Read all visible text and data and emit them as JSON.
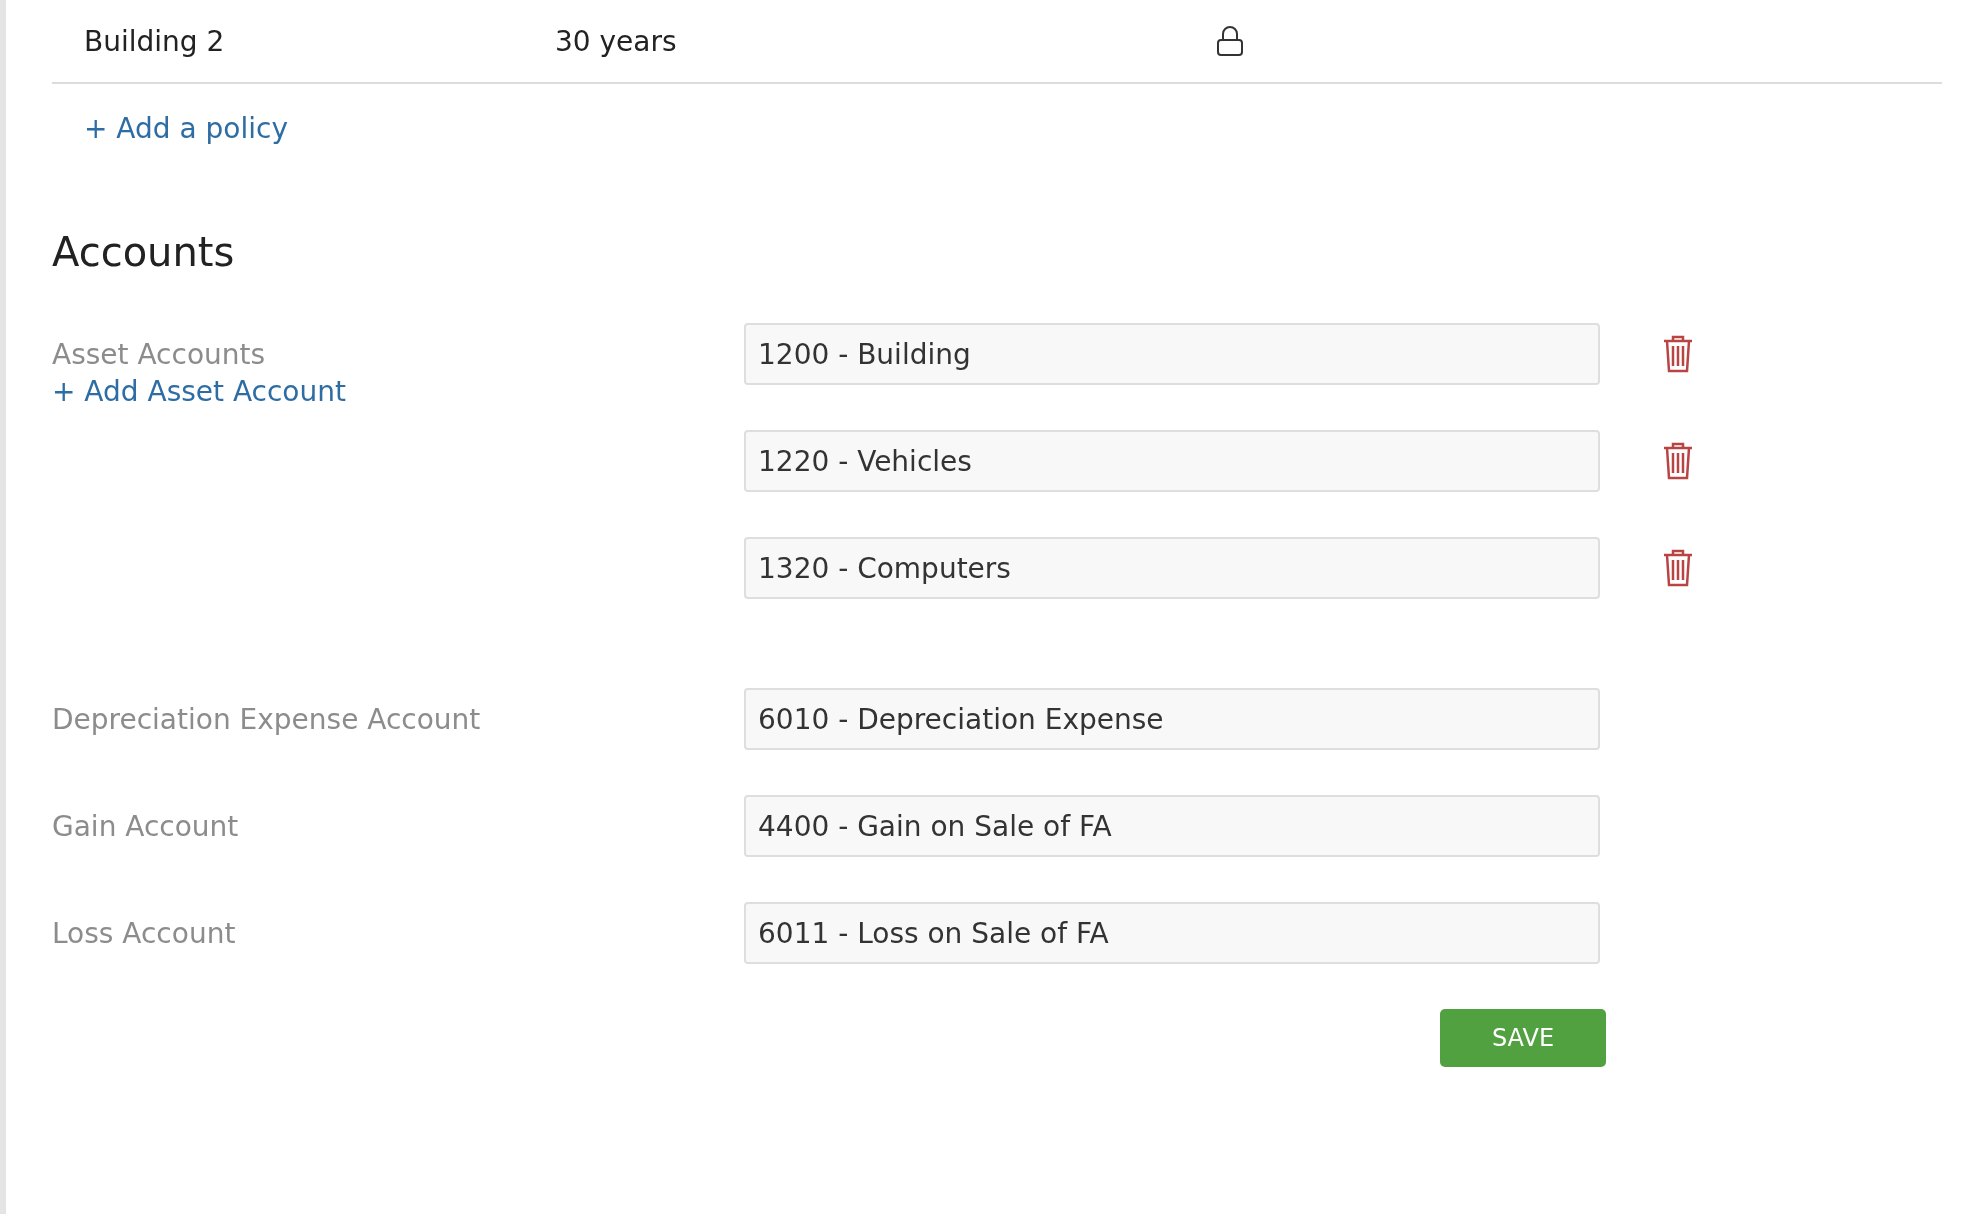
{
  "policy_row": {
    "name": "Building 2",
    "life": "30 years",
    "locked": true
  },
  "add_policy_link": "+ Add a policy",
  "accounts": {
    "title": "Accounts",
    "asset_accounts": {
      "label": "Asset Accounts",
      "add_link": "+ Add Asset Account",
      "values": [
        "1200 - Building",
        "1220 - Vehicles",
        "1320 - Computers"
      ]
    },
    "fields": [
      {
        "label": "Depreciation Expense Account",
        "value": "6010 - Depreciation Expense"
      },
      {
        "label": "Gain Account",
        "value": "4400 - Gain on Sale of FA"
      },
      {
        "label": "Loss Account",
        "value": "6011 - Loss on Sale of FA"
      }
    ],
    "save_button": "SAVE"
  }
}
